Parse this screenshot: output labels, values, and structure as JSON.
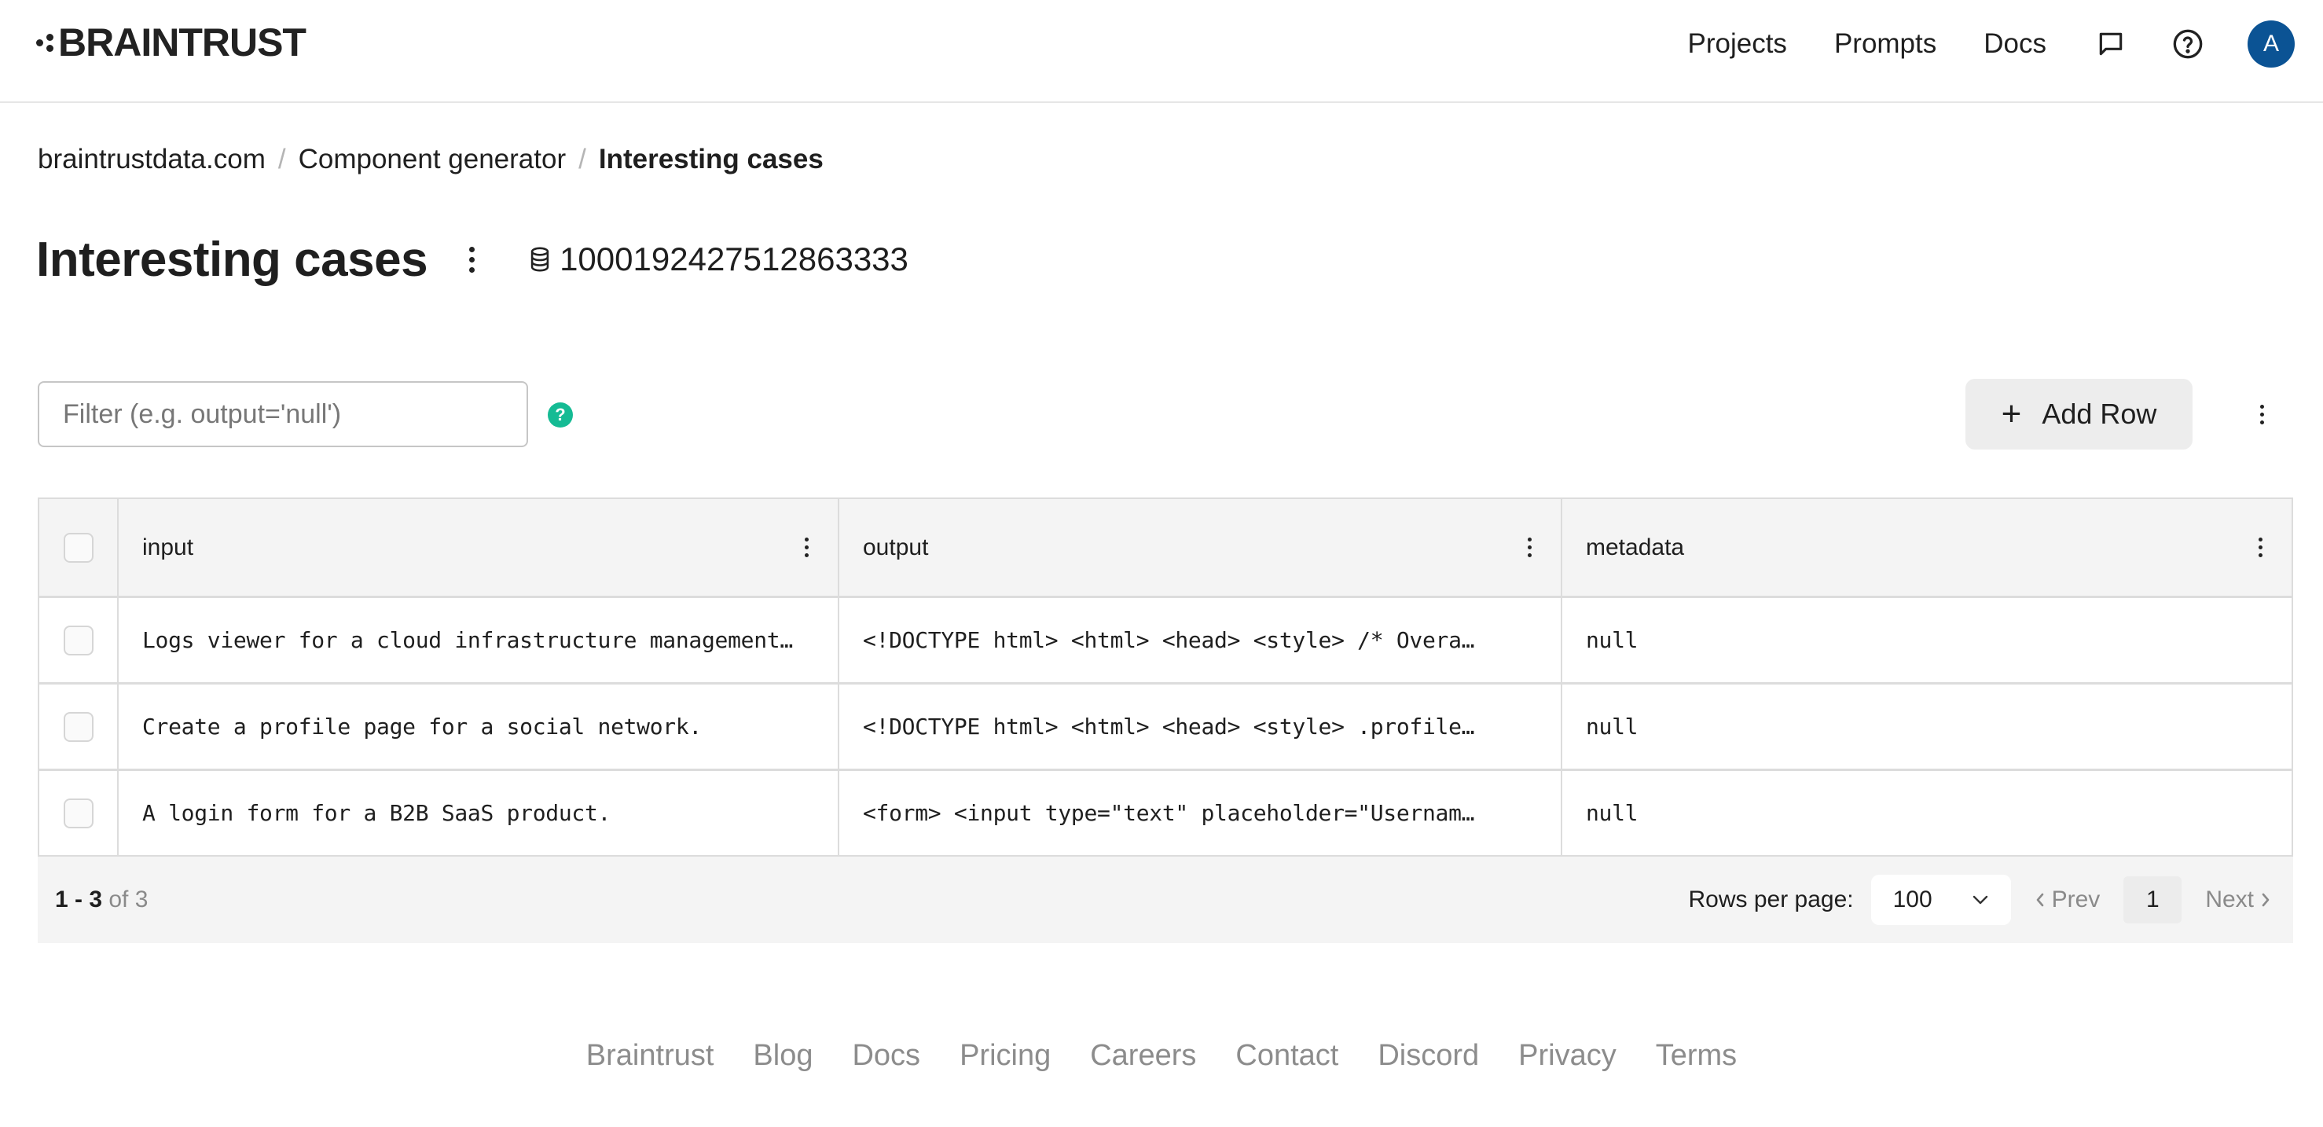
{
  "header": {
    "logo_text": "BRAINTRUST",
    "nav": [
      {
        "label": "Projects"
      },
      {
        "label": "Prompts"
      },
      {
        "label": "Docs"
      }
    ],
    "icons": [
      "chat-bubble-icon",
      "help-circle-icon"
    ],
    "avatar_initial": "A",
    "avatar_color": "#0b5394"
  },
  "breadcrumb": {
    "items": [
      "braintrustdata.com",
      "Component generator",
      "Interesting cases"
    ],
    "separator": "/"
  },
  "page": {
    "title": "Interesting cases",
    "dataset_icon": "database-icon",
    "dataset_id": "1000192427512863333"
  },
  "toolbar": {
    "filter_placeholder": "Filter (e.g. output='null')",
    "filter_value": "",
    "help_label": "?",
    "help_color": "#15bb94",
    "add_row_label": "Add Row",
    "add_row_icon": "plus-icon"
  },
  "table": {
    "columns": [
      "input",
      "output",
      "metadata"
    ],
    "rows": [
      {
        "input": "Logs viewer for a cloud infrastructure management…",
        "output": "<!DOCTYPE html> <html> <head> <style> /* Overa…",
        "metadata": "null"
      },
      {
        "input": "Create a profile page for a social network.",
        "output": "<!DOCTYPE html> <html> <head> <style> .profile…",
        "metadata": "null"
      },
      {
        "input": "A login form for a B2B SaaS product.",
        "output": "<form> <input type=\"text\" placeholder=\"Usernam…",
        "metadata": "null"
      }
    ]
  },
  "pagination": {
    "range": "1 - 3",
    "of_text": "of 3",
    "rows_per_page_label": "Rows per page:",
    "rows_per_page_value": "100",
    "prev_label": "Prev",
    "current_page": "1",
    "next_label": "Next"
  },
  "footer": {
    "links": [
      "Braintrust",
      "Blog",
      "Docs",
      "Pricing",
      "Careers",
      "Contact",
      "Discord",
      "Privacy",
      "Terms"
    ]
  }
}
